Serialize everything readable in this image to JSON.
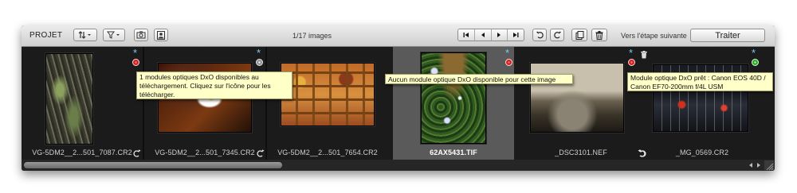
{
  "toolbar": {
    "project_label": "PROJET",
    "image_count": "1/17 images",
    "next_step_label": "Vers l'étape suivante",
    "process_button": "Traiter"
  },
  "icons": {
    "sort": "sort-arrows-icon",
    "filter": "filter-funnel-icon",
    "camera_info": "camera-info-icon",
    "preview": "preview-portrait-icon",
    "nav_first": "skip-first-icon",
    "nav_prev": "prev-icon",
    "nav_next": "next-icon",
    "nav_last": "skip-last-icon",
    "rotate_left": "rotate-left-icon",
    "rotate_right": "rotate-right-icon",
    "compare": "compare-icon",
    "trash": "trash-icon"
  },
  "thumbnails": [
    {
      "filename": "VG-5DM2__2...501_7087.CR2",
      "status": "red",
      "rotate": "right"
    },
    {
      "filename": "VG-5DM2__2...501_7345.CR2",
      "status": "gray",
      "rotate": "right"
    },
    {
      "filename": "VG-5DM2__2...501_7654.CR2",
      "status": "gray",
      "rotate": "right"
    },
    {
      "filename": "62AX5431.TIF",
      "status": "red",
      "rotate": "none",
      "selected": true
    },
    {
      "filename": "_DSC3101.NEF",
      "status": "red",
      "rotate": "left",
      "deleted": true
    },
    {
      "filename": "_MG_0569.CR2",
      "status": "green",
      "rotate": "left"
    }
  ],
  "tooltips": {
    "gray": "1 modules optiques DxO disponibles au téléchargement. Cliquez sur l'icône pour les télécharger.",
    "red": "Aucun module optique DxO disponible pour cette image",
    "green": "Module optique DxO prêt : Canon EOS 40D / Canon EF70-200mm f/4L USM"
  },
  "colors": {
    "strip_bg": "#1b1b1b",
    "selected_bg": "#5a5a5a",
    "star": "#7fc8f0",
    "tooltip_bg": "#ffffc8"
  }
}
